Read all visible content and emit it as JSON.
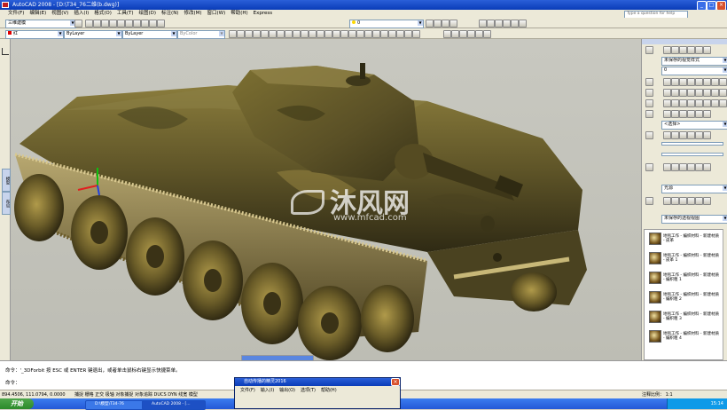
{
  "window": {
    "title": "AutoCAD 2008 - [D:\\T34_76二维(b.dwg)]",
    "help_placeholder": "Type a question for help"
  },
  "menu": {
    "items": [
      "文件(F)",
      "编辑(E)",
      "视图(V)",
      "插入(I)",
      "格式(O)",
      "工具(T)",
      "绘图(D)",
      "标注(N)",
      "修改(M)",
      "窗口(W)",
      "帮助(H)",
      "Express"
    ]
  },
  "toolbar": {
    "workspace": "三维建模",
    "ucs_value": "0",
    "layer_color": "红",
    "linetype": "ByLayer",
    "lineweight": "ByLayer",
    "plotstyle": "ByColor"
  },
  "left_tabs": [
    "模型",
    "布局"
  ],
  "palette": {
    "visual_style": "未保存的视觉样式",
    "layer_field": "0",
    "material_label": "<选择>",
    "light_label": "光源",
    "camera_label": "未保存的透视视图",
    "material_items": [
      {
        "name": "地毯工作 - 编织材料 - 新建材质 - 皮革"
      },
      {
        "name": "地毯工作 - 编织材料 - 新建材质 - 皮革 1"
      },
      {
        "name": "地毯工作 - 编织材料 - 新建材质 - 编织粗 1"
      },
      {
        "name": "地毯工作 - 编织材料 - 新建材质 - 编织粗 2"
      },
      {
        "name": "地毯工作 - 编织材料 - 新建材质 - 编织粗 3"
      },
      {
        "name": "地毯工作 - 编织材料 - 新建材质 - 编织粗 4"
      }
    ]
  },
  "viewport": {
    "watermark_cn": "沐风网",
    "watermark_en": "www.mfcad.com"
  },
  "command": {
    "line1": "命令：'_3DForbit 按 ESC 或 ENTER 键退出，或者单击鼠标右键显示快捷菜单。",
    "prompt": "命令："
  },
  "status": {
    "coords": "894.4506, 111.0794, 0.0000",
    "toggles": "捕捉 栅格 正交 极轴 对象捕捉 对象追踪 DUCS DYN 线宽 模型",
    "scale": "注释比例： 1:1"
  },
  "popup": {
    "title": "自动传播的精灵2016",
    "menu": [
      "文件(F)",
      "输入(I)",
      "输出(O)",
      "选项(T)",
      "帮助(H)"
    ]
  },
  "taskbar": {
    "start": "开始",
    "items": [
      "D:\\模型\\T34-76",
      "AutoCAD 2008 - [..."
    ],
    "clock": "15:14"
  },
  "colors": {
    "titlebar": "#0a3cb8",
    "taskbar": "#2458d6",
    "viewport_bg": "#c4c4bc",
    "tank_body": "#6d6230"
  }
}
